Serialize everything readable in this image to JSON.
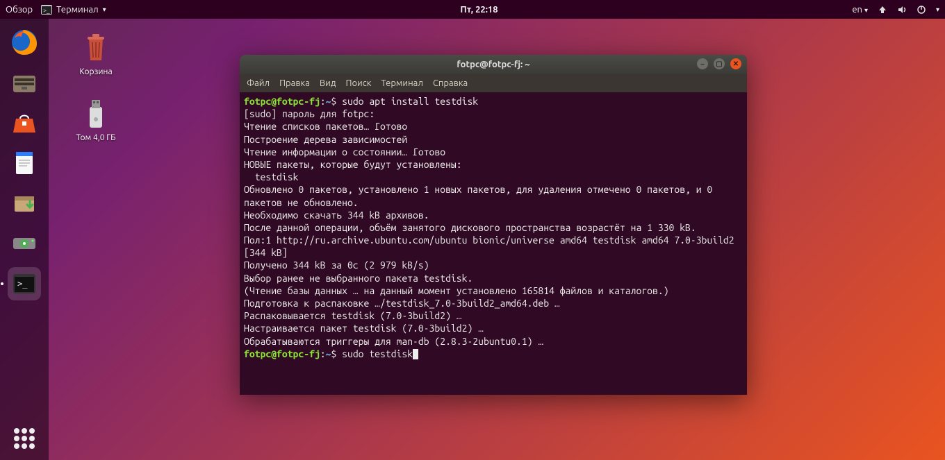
{
  "top_panel": {
    "activities": "Обзор",
    "app_name": "Терминал",
    "clock": "Пт, 22:18",
    "lang": "en"
  },
  "desktop": {
    "trash_label": "Корзина",
    "volume_label": "Том 4,0 ГБ"
  },
  "terminal": {
    "title": "fotpc@fotpc-fj: ~",
    "menu": {
      "file": "Файл",
      "edit": "Правка",
      "view": "Вид",
      "search": "Поиск",
      "terminal": "Терминал",
      "help": "Справка"
    },
    "prompt_user": "fotpc@fotpc-fj",
    "prompt_path": "~",
    "cmd1": "sudo apt install testdisk",
    "cmd2": "sudo testdisk",
    "output": "[sudo] пароль для fotpc: \nЧтение списков пакетов… Готово\nПостроение дерева зависимостей       \nЧтение информации о состоянии… Готово\nНОВЫЕ пакеты, которые будут установлены:\n  testdisk\nОбновлено 0 пакетов, установлено 1 новых пакетов, для удаления отмечено 0 пакетов, и 0 пакетов не обновлено.\nНеобходимо скачать 344 kB архивов.\nПосле данной операции, объём занятого дискового пространства возрастёт на 1 330 kB.\nПол:1 http://ru.archive.ubuntu.com/ubuntu bionic/universe amd64 testdisk amd64 7.0-3build2 [344 kB]\nПолучено 344 kB за 0с (2 979 kB/s)\nВыбор ранее не выбранного пакета testdisk.\n(Чтение базы данных … на данный момент установлено 165814 файлов и каталогов.)\nПодготовка к распаковке …/testdisk_7.0-3build2_amd64.deb …\nРаспаковывается testdisk (7.0-3build2) …\nНастраивается пакет testdisk (7.0-3build2) …\nОбрабатываются триггеры для man-db (2.8.3-2ubuntu0.1) …"
  }
}
